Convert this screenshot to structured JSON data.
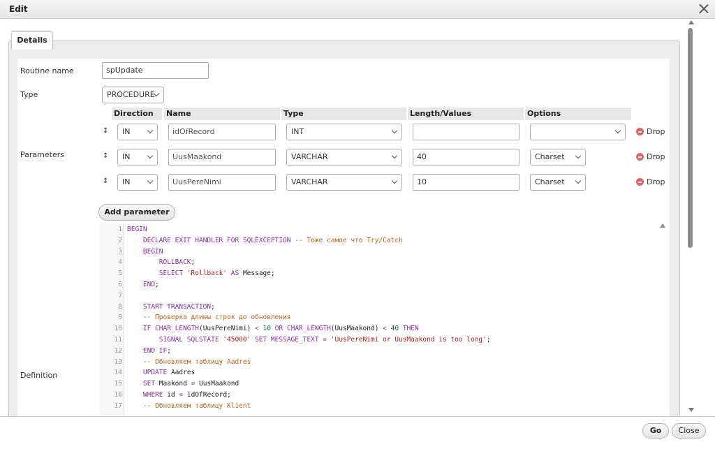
{
  "dialog": {
    "title": "Edit"
  },
  "tab": {
    "label": "Details"
  },
  "routine": {
    "name_label": "Routine name",
    "name_value": "spUpdate",
    "type_label": "Type",
    "type_value": "PROCEDURE"
  },
  "parameters": {
    "label": "Parameters",
    "headers": {
      "direction": "Direction",
      "name": "Name",
      "type": "Type",
      "length": "Length/Values",
      "options": "Options"
    },
    "rows": [
      {
        "drag": "↕",
        "direction": "IN",
        "name": "idOfRecord",
        "type": "INT",
        "length": "",
        "options": "",
        "drop": "Drop"
      },
      {
        "drag": "↕",
        "direction": "IN",
        "name": "UusMaakond",
        "type": "VARCHAR",
        "length": "40",
        "options": "Charset",
        "drop": "Drop"
      },
      {
        "drag": "↕",
        "direction": "IN",
        "name": "UusPereNimi",
        "type": "VARCHAR",
        "length": "10",
        "options": "Charset",
        "drop": "Drop"
      }
    ],
    "add_label": "Add parameter"
  },
  "definition": {
    "label": "Definition",
    "line_numbers": [
      "1",
      "2",
      "3",
      "4",
      "5",
      "6",
      "7",
      "8",
      "9",
      "10",
      "11",
      "12",
      "13",
      "14",
      "15",
      "16",
      "17"
    ]
  },
  "footer": {
    "go_label": "Go",
    "close_label": "Close"
  },
  "colors": {
    "keyword": "#8a2fa0",
    "string": "#a51f1f",
    "comment": "#b2641c",
    "number": "#116644"
  }
}
